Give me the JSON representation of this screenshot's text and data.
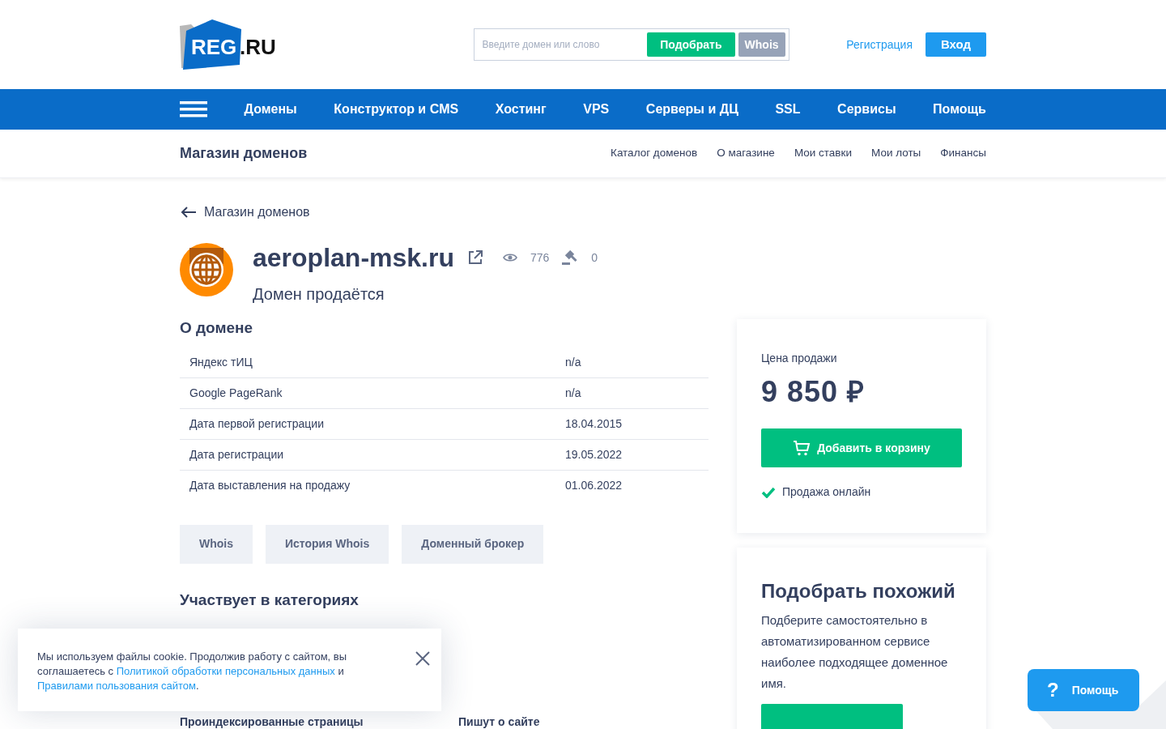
{
  "header": {
    "logo": "REG.RU",
    "search": {
      "placeholder": "Введите домен или слово"
    },
    "pick_button": "Подобрать",
    "whois_button": "Whois",
    "register_link": "Регистрация",
    "login_button": "Вход"
  },
  "main_nav": [
    "Домены",
    "Конструктор и CMS",
    "Хостинг",
    "VPS",
    "Серверы и ДЦ",
    "SSL",
    "Сервисы",
    "Помощь"
  ],
  "sub_nav": {
    "title": "Магазин доменов",
    "links": [
      "Каталог доменов",
      "О магазине",
      "Мои ставки",
      "Мои лоты",
      "Финансы"
    ]
  },
  "back_link": "Магазин доменов",
  "domain": {
    "name": "aeroplan-msk.ru",
    "views": "776",
    "bids": "0",
    "status": "Домен продаётся"
  },
  "about": {
    "title": "О домене",
    "rows": [
      {
        "label": "Яндекс тИЦ",
        "value": "n/a"
      },
      {
        "label": "Google PageRank",
        "value": "n/a"
      },
      {
        "label": "Дата первой регистрации",
        "value": "18.04.2015"
      },
      {
        "label": "Дата регистрации",
        "value": "19.05.2022"
      },
      {
        "label": "Дата выставления на продажу",
        "value": "01.06.2022"
      }
    ]
  },
  "action_buttons": [
    "Whois",
    "История Whois",
    "Доменный брокер"
  ],
  "categories_title": "Участвует в категориях",
  "bottom_headings": [
    "Проиндексированные страницы",
    "Пишут о сайте"
  ],
  "price_card": {
    "label": "Цена продажи",
    "price": "9 850 ₽",
    "cart_button": "Добавить в корзину",
    "online_sale": true,
    "online_label": "Продажа онлайн"
  },
  "similar_card": {
    "title": "Подобрать похожий",
    "text": "Подберите самостоятельно в автоматизированном сервисе наиболее подходящее доменное имя."
  },
  "cookie": {
    "text_start": "Мы используем файлы cookie. Продолжив работу с сайтом, вы соглашаетесь с ",
    "link1": "Политикой обработки персональных данных",
    "middle": " и ",
    "link2": "Правилами пользования сайтом",
    "end": "."
  },
  "help_button": {
    "icon": "?",
    "label": "Помощь"
  }
}
